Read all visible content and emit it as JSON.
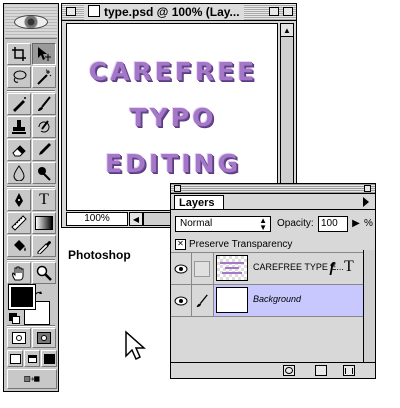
{
  "document": {
    "title": "type.psd @ 100% (Lay...",
    "canvas_lines": [
      "CAREFREE",
      "TYPO",
      "EDITING"
    ],
    "zoom": "100%",
    "text_color": "#a577c8"
  },
  "toolbox": {
    "tools": [
      "crop-icon",
      "move-icon",
      "lasso-icon",
      "magic-wand-icon",
      "airbrush-icon",
      "paintbrush-icon",
      "rubber-stamp-icon",
      "history-brush-icon",
      "eraser-icon",
      "pencil-icon",
      "blur-icon",
      "dodge-icon",
      "pen-icon",
      "type-icon",
      "measure-icon",
      "gradient-icon",
      "paint-bucket-icon",
      "eyedropper-icon",
      "hand-icon",
      "zoom-icon"
    ],
    "foreground": "#000000",
    "background": "#ffffff"
  },
  "label": "Photoshop",
  "layers_palette": {
    "tab": "Layers",
    "blend_mode": "Normal",
    "opacity_label": "Opacity:",
    "opacity_value": "100",
    "opacity_unit": "%",
    "preserve_transparency": "Preserve Transparency",
    "preserve_checked": "✕",
    "layers": [
      {
        "name": "CAREFREE TYPE E...",
        "type_badge": "T",
        "effect_badge": "ƒ",
        "selected": false
      },
      {
        "name": "Background",
        "selected": true
      }
    ],
    "selection_color": "#c8c8ff"
  }
}
